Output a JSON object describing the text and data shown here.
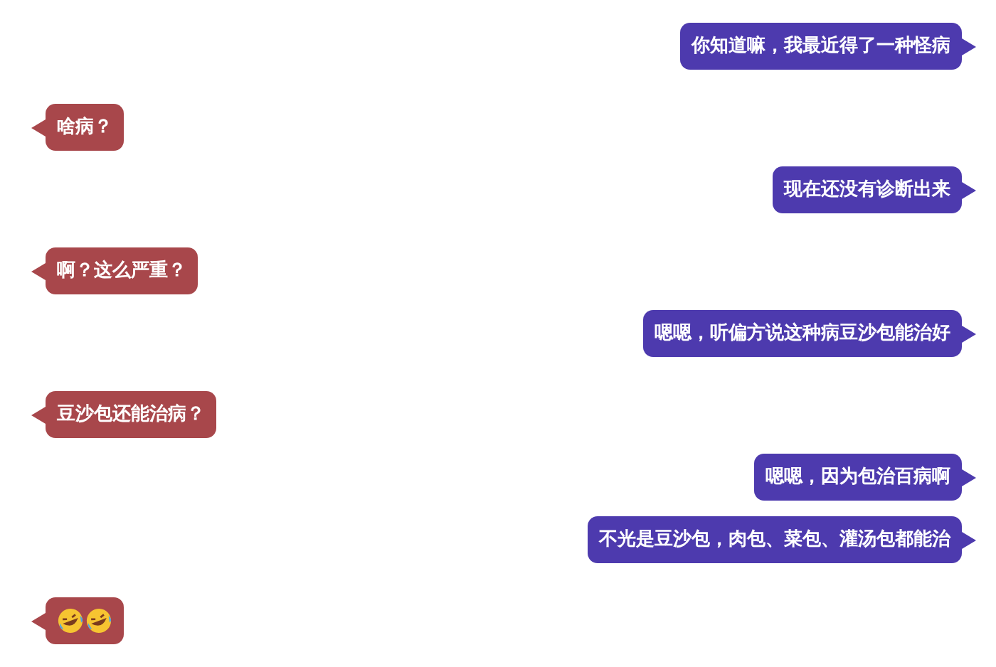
{
  "messages": [
    {
      "outgoing": true,
      "kind": "text",
      "text": "你知道嘛，我最近得了一种怪病"
    },
    {
      "outgoing": false,
      "kind": "text",
      "text": "啥病？"
    },
    {
      "outgoing": true,
      "kind": "text",
      "text": "现在还没有诊断出来"
    },
    {
      "outgoing": false,
      "kind": "text",
      "text": "啊？这么严重？"
    },
    {
      "outgoing": true,
      "kind": "text",
      "text": "嗯嗯，听偏方说这种病豆沙包能治好"
    },
    {
      "outgoing": false,
      "kind": "text",
      "text": "豆沙包还能治病？"
    },
    {
      "outgoing": true,
      "kind": "text",
      "text": "嗯嗯，因为包治百病啊"
    },
    {
      "outgoing": true,
      "kind": "text",
      "text": "不光是豆沙包，肉包、菜包、灌汤包都能治"
    },
    {
      "outgoing": false,
      "kind": "sticker"
    }
  ]
}
